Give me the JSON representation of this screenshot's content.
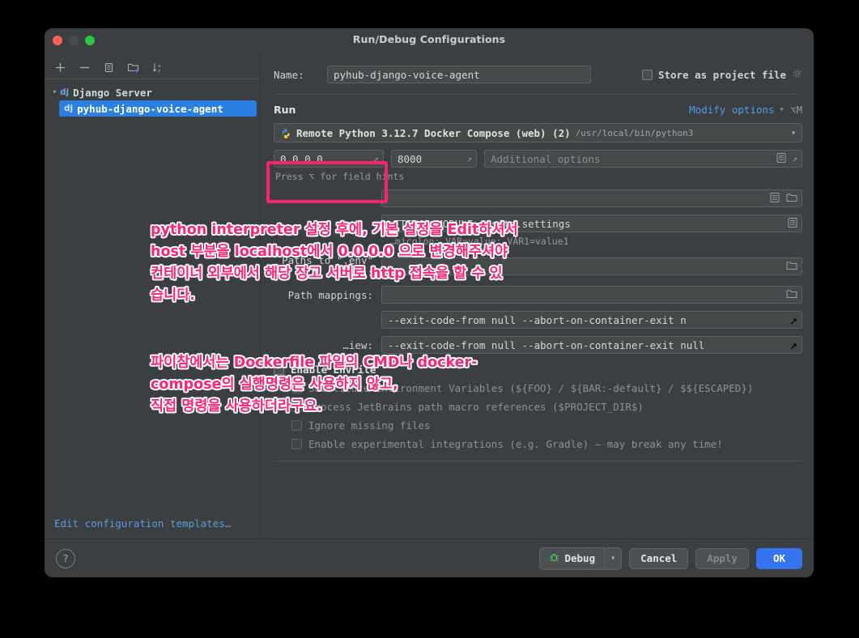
{
  "window": {
    "title": "Run/Debug Configurations",
    "traffic_lights": [
      "close-red",
      "minimize-gray",
      "maximize-green"
    ]
  },
  "sidebar": {
    "toolbar_icons": [
      "add-icon",
      "remove-icon",
      "copy-icon",
      "new-folder-icon",
      "sort-icon"
    ],
    "tree": [
      {
        "label": "Django Server",
        "badge": "dj",
        "type": "group",
        "expanded": true
      },
      {
        "label": "pyhub-django-voice-agent",
        "badge": "dj",
        "type": "item",
        "selected": true
      }
    ],
    "edit_templates_link": "Edit configuration templates…"
  },
  "form": {
    "name_label": "Name:",
    "name_value": "pyhub-django-voice-agent",
    "store_as_project_file": "Store as project file",
    "store_gear_icon": "gear-icon",
    "run_section_title": "Run",
    "modify_options": "Modify options",
    "modify_shortcut": "⌥M",
    "interpreter": {
      "icon": "python-docker-icon",
      "name": "Remote Python 3.12.7 Docker Compose (web) (2)",
      "path": "/usr/local/bin/python3"
    },
    "host_value": "0.0.0.0",
    "port_value": "8000",
    "additional_options_placeholder": "Additional options",
    "field_hint": "Press ⌥ for field hints",
    "env_value": "…TTINGS_MODULE=mysite.settings",
    "env_hint": "…micolon: VAR=value; VAR1=value1",
    "paths_env_label": "Paths to \".env\" files:",
    "paths_env_value": "",
    "path_mappings_label": "Path mappings:",
    "path_mappings_value": "",
    "compose_cmd_value": "--exit-code-from null --abort-on-container-exit n",
    "compose_preview_label": "…iew:",
    "compose_preview_value": "--exit-code-from null --abort-on-container-exit null",
    "enable_envfile": "Enable EnvFile",
    "envfile_options": [
      "Substitute Environment Variables (${FOO} / ${BAR:-default} / $${ESCAPED})",
      "Process JetBrains path macro references ($PROJECT_DIR$)",
      "Ignore missing files",
      "Enable experimental integrations (e.g. Gradle) — may break any time!"
    ]
  },
  "footer": {
    "help": "?",
    "debug": "Debug",
    "cancel": "Cancel",
    "apply": "Apply",
    "ok": "OK"
  },
  "annotations": {
    "note1": "python interpreter 설정 후에, 기본 설정을 Edit하셔서\nhost 부분을 localhost에서 0.0.0.0 으로 변경해주셔야\n컨테이너 외부에서 해당 장고 서버로 http 접속을 할 수 있\n습니다.",
    "note2": "파이참에서는 Dockerfile 파일의 CMD나 docker-\ncompose의 실행명령은 사용하지 않고,\n직접 명령을 사용하더라구요.",
    "highlight_color": "#f4256c",
    "text_color": "#fb2576"
  }
}
